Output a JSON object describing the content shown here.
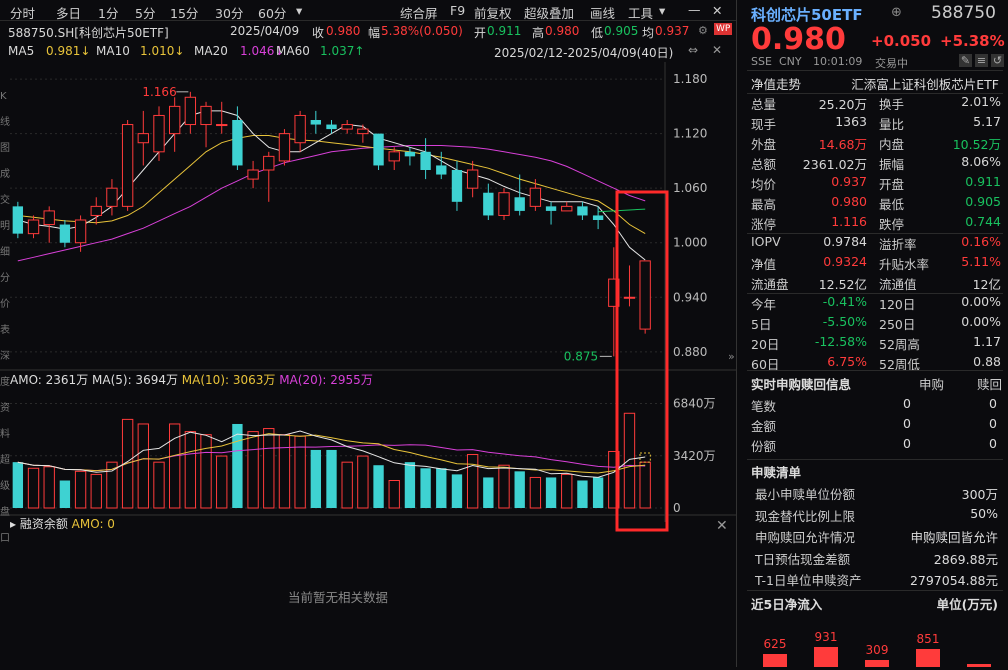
{
  "toolbar": {
    "left": [
      "分时",
      "多日",
      "1分",
      "5分",
      "15分",
      "30分",
      "60分"
    ],
    "dropdown": "▾",
    "right": [
      "综合屏",
      "F9",
      "前复权",
      "超级叠加",
      "画线",
      "工具"
    ]
  },
  "info": {
    "code": "588750.SH[科创芯片50ETF]",
    "date": "2025/04/09",
    "close_label": "收",
    "close": "0.980",
    "amp_label": "幅",
    "amp": "5.38%(0.050)",
    "open_label": "开",
    "open": "0.911",
    "high_label": "高",
    "high": "0.980",
    "low_label": "低",
    "low": "0.905",
    "avg_label": "均",
    "avg": "0.937"
  },
  "ma": {
    "ma5": "MA5",
    "ma5v": "0.981↓",
    "ma10": "MA10",
    "ma10v": "1.010↓",
    "ma20": "MA20",
    "ma20v": "1.046↓",
    "ma60": "MA60",
    "ma60v": "1.037↑",
    "range": "2025/02/12-2025/04/09(40日)"
  },
  "price_axis": [
    "1.180",
    "1.120",
    "1.060",
    "1.000",
    "0.940",
    "0.880"
  ],
  "annot": {
    "high": "1.166",
    "low": "0.875"
  },
  "vol": {
    "amo": "AMO: 2361万",
    "ma5": "MA(5): 3694万",
    "ma10": "MA(10): 3063万",
    "ma20": "MA(20): 2955万",
    "axis": [
      "6840万",
      "3420万",
      "0"
    ]
  },
  "fin": {
    "title": "融资余额",
    "amo": "AMO: 0",
    "empty": "当前暂无相关数据"
  },
  "left_edge": [
    "K",
    "线",
    "图",
    "成",
    "交",
    "明",
    "细",
    "分",
    "价",
    "表",
    "深",
    "度",
    "资",
    "料",
    "超",
    "级",
    "盘",
    "口"
  ],
  "colors": {
    "up": "#ff3b3b",
    "down": "#3ed2d2",
    "ma5": "#e6e6e6",
    "ma10": "#e8c33a",
    "ma20": "#d840d8",
    "ma60": "#19c15f",
    "highlight": "#ff2a2a"
  },
  "chart_data": {
    "type": "candlestick",
    "ylim": [
      0.86,
      1.19
    ],
    "candles": [
      [
        1.04,
        1.045,
        1.005,
        1.01
      ],
      [
        1.01,
        1.03,
        1.005,
        1.025
      ],
      [
        1.02,
        1.04,
        1.0,
        1.035
      ],
      [
        1.02,
        1.025,
        0.995,
        1.0
      ],
      [
        1.0,
        1.03,
        0.99,
        1.025
      ],
      [
        1.03,
        1.05,
        1.02,
        1.04
      ],
      [
        1.04,
        1.07,
        1.03,
        1.06
      ],
      [
        1.04,
        1.135,
        1.035,
        1.13
      ],
      [
        1.11,
        1.145,
        1.085,
        1.12
      ],
      [
        1.1,
        1.15,
        1.09,
        1.14
      ],
      [
        1.12,
        1.16,
        1.1,
        1.15
      ],
      [
        1.13,
        1.166,
        1.12,
        1.16
      ],
      [
        1.13,
        1.155,
        1.105,
        1.15
      ],
      [
        1.13,
        1.155,
        1.12,
        1.13
      ],
      [
        1.135,
        1.15,
        1.08,
        1.085
      ],
      [
        1.07,
        1.09,
        1.06,
        1.08
      ],
      [
        1.08,
        1.1,
        1.045,
        1.095
      ],
      [
        1.09,
        1.125,
        1.085,
        1.12
      ],
      [
        1.11,
        1.145,
        1.1,
        1.14
      ],
      [
        1.135,
        1.145,
        1.12,
        1.13
      ],
      [
        1.13,
        1.135,
        1.12,
        1.125
      ],
      [
        1.125,
        1.135,
        1.12,
        1.13
      ],
      [
        1.12,
        1.13,
        1.11,
        1.125
      ],
      [
        1.12,
        1.12,
        1.08,
        1.085
      ],
      [
        1.09,
        1.105,
        1.08,
        1.1
      ],
      [
        1.1,
        1.105,
        1.085,
        1.095
      ],
      [
        1.1,
        1.115,
        1.07,
        1.08
      ],
      [
        1.085,
        1.1,
        1.07,
        1.075
      ],
      [
        1.08,
        1.09,
        1.035,
        1.045
      ],
      [
        1.06,
        1.09,
        1.05,
        1.08
      ],
      [
        1.055,
        1.065,
        1.025,
        1.03
      ],
      [
        1.03,
        1.06,
        1.025,
        1.055
      ],
      [
        1.05,
        1.075,
        1.03,
        1.035
      ],
      [
        1.04,
        1.07,
        1.035,
        1.06
      ],
      [
        1.04,
        1.045,
        1.02,
        1.035
      ],
      [
        1.035,
        1.045,
        1.035,
        1.04
      ],
      [
        1.04,
        1.045,
        1.025,
        1.03
      ],
      [
        1.03,
        1.04,
        1.015,
        1.025
      ],
      [
        0.93,
        0.995,
        0.875,
        0.96
      ],
      [
        0.94,
        0.975,
        0.93,
        0.94
      ],
      [
        0.905,
        0.98,
        0.9,
        0.98
      ]
    ],
    "volumes": [
      30,
      26,
      27,
      18,
      24,
      22,
      30,
      58,
      55,
      30,
      55,
      50,
      48,
      34,
      55,
      50,
      52,
      48,
      47,
      38,
      38,
      30,
      34,
      28,
      18,
      30,
      26,
      26,
      22,
      35,
      20,
      28,
      24,
      20,
      20,
      22,
      18,
      20,
      37,
      62,
      30
    ],
    "ma_lines": {
      "ma5": [
        1.025,
        1.02,
        1.018,
        1.015,
        1.018,
        1.028,
        1.04,
        1.06,
        1.08,
        1.1,
        1.12,
        1.14,
        1.145,
        1.145,
        1.14,
        1.12,
        1.105,
        1.1,
        1.1,
        1.11,
        1.12,
        1.13,
        1.128,
        1.115,
        1.11,
        1.105,
        1.1,
        1.09,
        1.08,
        1.075,
        1.07,
        1.062,
        1.055,
        1.05,
        1.045,
        1.045,
        1.045,
        1.04,
        1.02,
        0.995,
        0.981
      ],
      "ma10": [
        1.03,
        1.028,
        1.026,
        1.024,
        1.023,
        1.022,
        1.024,
        1.03,
        1.04,
        1.055,
        1.07,
        1.085,
        1.1,
        1.11,
        1.115,
        1.118,
        1.118,
        1.115,
        1.113,
        1.112,
        1.11,
        1.108,
        1.106,
        1.104,
        1.102,
        1.1,
        1.097,
        1.094,
        1.09,
        1.086,
        1.082,
        1.076,
        1.07,
        1.065,
        1.06,
        1.055,
        1.05,
        1.046,
        1.035,
        1.02,
        1.01
      ],
      "ma20": [
        0.98,
        0.984,
        0.988,
        0.992,
        0.996,
        1.0,
        1.004,
        1.01,
        1.016,
        1.024,
        1.032,
        1.04,
        1.05,
        1.06,
        1.068,
        1.076,
        1.082,
        1.088,
        1.092,
        1.096,
        1.1,
        1.102,
        1.104,
        1.105,
        1.106,
        1.107,
        1.107,
        1.107,
        1.106,
        1.105,
        1.103,
        1.1,
        1.097,
        1.094,
        1.09,
        1.084,
        1.076,
        1.068,
        1.06,
        1.052,
        1.046
      ],
      "ma60": [
        null,
        null,
        null,
        null,
        null,
        null,
        null,
        null,
        null,
        null,
        null,
        null,
        null,
        null,
        null,
        null,
        null,
        null,
        null,
        null,
        null,
        null,
        null,
        null,
        null,
        null,
        null,
        null,
        null,
        null,
        null,
        null,
        null,
        null,
        null,
        null,
        null,
        1.034,
        1.035,
        1.036,
        1.037
      ]
    }
  },
  "side": {
    "name": "科创芯片50ETF",
    "code": "588750",
    "price": "0.980",
    "chg": "+0.050",
    "pct": "+5.38%",
    "market": "SSE",
    "cny": "CNY",
    "time": "10:01:09",
    "status": "交易中",
    "rows": [
      [
        "净值走势",
        "汇添富上证科创板芯片ETF",
        "",
        ""
      ],
      [
        "总量",
        "25.20万",
        "换手",
        "2.01%"
      ],
      [
        "现手",
        "1363",
        "量比",
        "5.17"
      ],
      [
        "外盘",
        "14.68万",
        "内盘",
        "10.52万"
      ],
      [
        "总额",
        "2361.02万",
        "振幅",
        "8.06%"
      ],
      [
        "均价",
        "0.937",
        "开盘",
        "0.911"
      ],
      [
        "最高",
        "0.980",
        "最低",
        "0.905"
      ],
      [
        "涨停",
        "1.116",
        "跌停",
        "0.744"
      ],
      [
        "IOPV",
        "0.9784",
        "溢折率",
        "0.16%"
      ],
      [
        "净值",
        "0.9324",
        "升贴水率",
        "5.11%"
      ],
      [
        "流通盘",
        "12.52亿",
        "流通值",
        "12亿"
      ],
      [
        "今年",
        "-0.41%",
        "120日",
        "0.00%"
      ],
      [
        "5日",
        "-5.50%",
        "250日",
        "0.00%"
      ],
      [
        "20日",
        "-12.58%",
        "52周高",
        "1.17"
      ],
      [
        "60日",
        "6.75%",
        "52周低",
        "0.88"
      ]
    ],
    "sg_title": "实时申购赎回信息",
    "sg_h1": "申购",
    "sg_h2": "赎回",
    "sg": [
      [
        "笔数",
        "0",
        "0"
      ],
      [
        "金额",
        "0",
        "0"
      ],
      [
        "份额",
        "0",
        "0"
      ]
    ],
    "list_title": "申赎清单",
    "list": [
      [
        "最小申赎单位份额",
        "300万"
      ],
      [
        "现金替代比例上限",
        "50%"
      ],
      [
        "申购赎回允许情况",
        "申购赎回皆允许"
      ],
      [
        "T日预估现金差额",
        "2869.88元"
      ],
      [
        "T-1日单位申赎资产",
        "2797054.88元"
      ]
    ],
    "flow_title": "近5日净流入",
    "flow_unit": "单位(万元)",
    "flow": [
      625,
      931,
      309,
      851
    ]
  }
}
